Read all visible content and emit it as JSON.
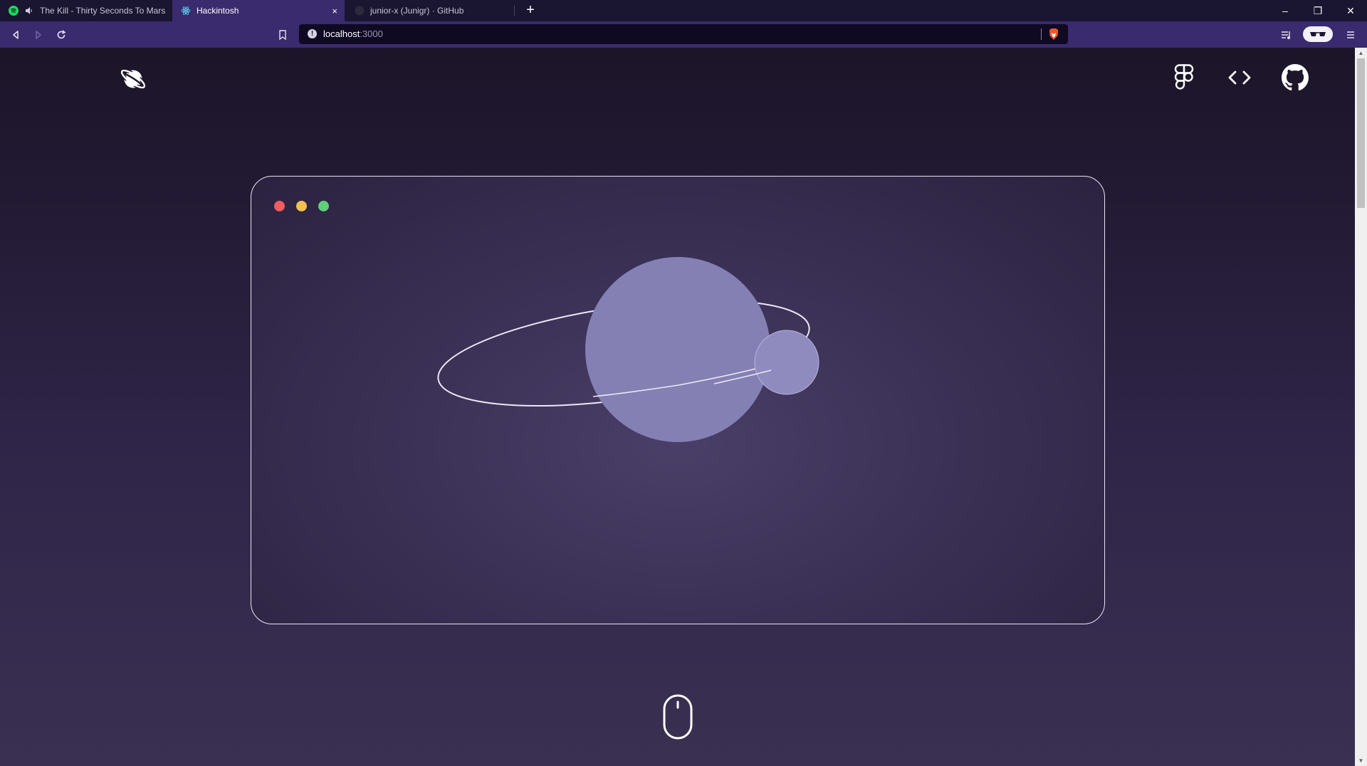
{
  "browser": {
    "tabs": [
      {
        "label": "The Kill - Thirty Seconds To Mars",
        "favicon": "spotify-icon",
        "audio": true,
        "active": false
      },
      {
        "label": "Hackintosh",
        "favicon": "react-icon",
        "active": true,
        "close": "×"
      },
      {
        "label": "junior-x (Junigr) · GitHub",
        "favicon": "github-icon",
        "active": false
      }
    ],
    "new_tab": "+",
    "window_controls": {
      "minimize": "–",
      "restore": "❐",
      "close": "✕"
    },
    "address": {
      "host": "localhost",
      "port": ":3000"
    },
    "colors": {
      "tabbar": "#1a1530",
      "toolbar": "#3a2a6e",
      "urlbar": "#0f0a22"
    }
  },
  "page": {
    "header_icons": [
      "planet-logo-icon",
      "figma-icon",
      "code-brackets-icon",
      "github-icon"
    ],
    "window_dots": {
      "red": "#f05d5e",
      "yellow": "#f3bf4f",
      "green": "#5fd07a"
    },
    "illustration": {
      "planet_color": "#8480b4",
      "orbit_color": "#ece8f4"
    },
    "scroll_hint": "mouse-icon"
  }
}
